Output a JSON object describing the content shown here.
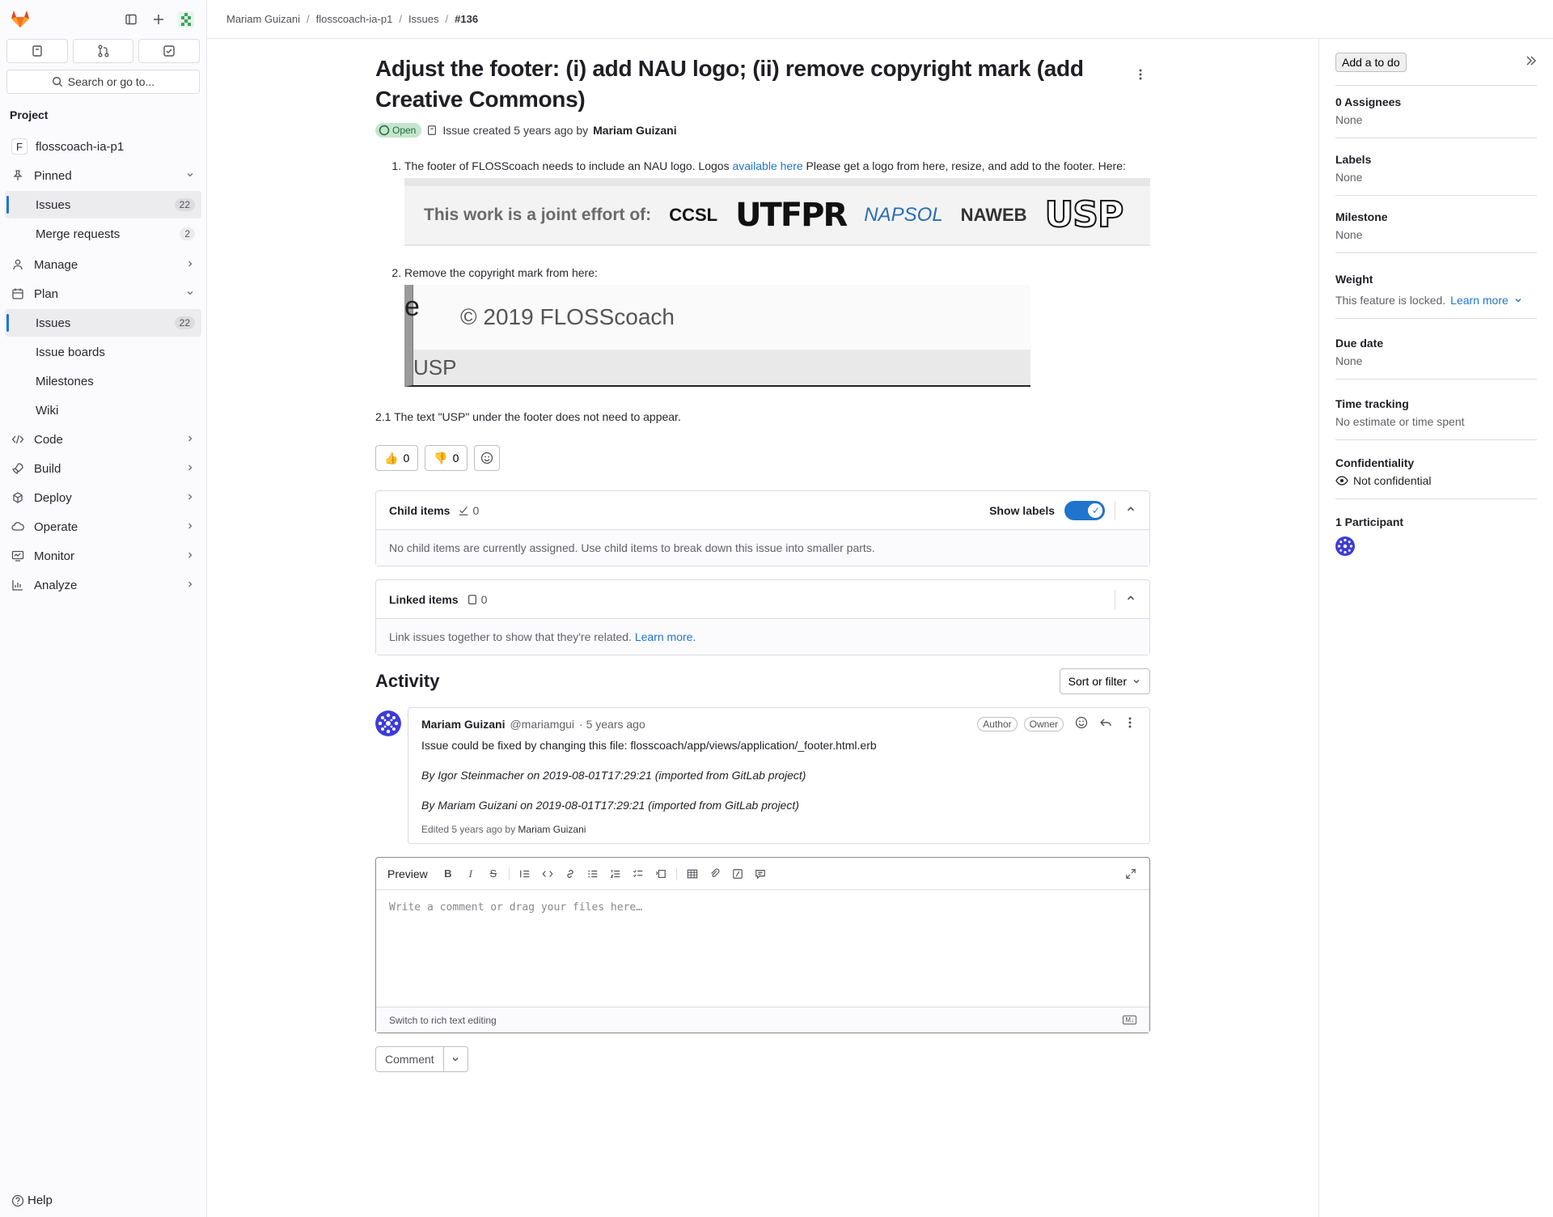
{
  "breadcrumb": [
    "Mariam Guizani",
    "flosscoach-ia-p1",
    "Issues",
    "#136"
  ],
  "sidebar": {
    "search_label": "Search or go to...",
    "section_title": "Project",
    "project_initial": "F",
    "project_name": "flosscoach-ia-p1",
    "pinned_label": "Pinned",
    "pinned_items": [
      {
        "label": "Issues",
        "count": "22"
      },
      {
        "label": "Merge requests",
        "count": "2"
      }
    ],
    "manage_label": "Manage",
    "plan_label": "Plan",
    "plan_items": [
      {
        "label": "Issues",
        "count": "22"
      },
      {
        "label": "Issue boards"
      },
      {
        "label": "Milestones"
      },
      {
        "label": "Wiki"
      }
    ],
    "groups": [
      "Code",
      "Build",
      "Deploy",
      "Operate",
      "Monitor",
      "Analyze"
    ],
    "help_label": "Help"
  },
  "issue": {
    "title": "Adjust the footer: (i) add NAU logo; (ii) remove copyright mark (add Creative Commons)",
    "status": "Open",
    "created_text": "Issue created 5 years ago by",
    "author": "Mariam Guizani",
    "desc_item1_pre": "The footer of FLOSScoach needs to include an NAU logo. Logos",
    "desc_item1_link": "available here",
    "desc_item1_post": "Please get a logo from here, resize, and add to the footer. Here:",
    "desc_item2": "Remove the copyright mark from here:",
    "desc_note": "2.1 The text \"USP\" under the footer does not need to appear.",
    "logos_image": {
      "joint_text": "This work is a joint effort of:",
      "logos": [
        "CCSL",
        "UTFPR",
        "NAPSOL",
        "NAWEB",
        "USP"
      ]
    },
    "copyright_image": {
      "text": "© 2019 FLOSScoach",
      "footer_text": "USP",
      "edge_glyph": "e"
    }
  },
  "reactions": {
    "thumbs_up": "0",
    "thumbs_down": "0"
  },
  "child_items": {
    "title": "Child items",
    "count": "0",
    "show_labels": "Show labels",
    "empty_text": "No child items are currently assigned. Use child items to break down this issue into smaller parts."
  },
  "linked_items": {
    "title": "Linked items",
    "count": "0",
    "text": "Link issues together to show that they're related.",
    "link": "Learn more."
  },
  "activity": {
    "title": "Activity",
    "sort_label": "Sort or filter",
    "note": {
      "author": "Mariam Guizani",
      "handle": "@mariamgui",
      "time": "· 5 years ago",
      "badges": [
        "Author",
        "Owner"
      ],
      "body": "Issue could be fixed by changing this file: flosscoach/app/views/application/_footer.html.erb",
      "line2": "By Igor Steinmacher on 2019-08-01T17:29:21 (imported from GitLab project)",
      "line3": "By Mariam Guizani on 2019-08-01T17:29:21 (imported from GitLab project)",
      "edited_prefix": "Edited 5 years ago by",
      "edited_by": "Mariam Guizani"
    }
  },
  "editor": {
    "preview_label": "Preview",
    "placeholder": "Write a comment or drag your files here…",
    "switch_label": "Switch to rich text editing",
    "md_badge": "M↓",
    "comment_label": "Comment"
  },
  "right_sidebar": {
    "todo_label": "Add a to do",
    "assignees_title": "0 Assignees",
    "assignees_value": "None",
    "labels_title": "Labels",
    "labels_value": "None",
    "milestone_title": "Milestone",
    "milestone_value": "None",
    "weight_title": "Weight",
    "weight_value": "This feature is locked.",
    "weight_link": "Learn more",
    "due_title": "Due date",
    "due_value": "None",
    "time_title": "Time tracking",
    "time_value": "No estimate or time spent",
    "conf_title": "Confidentiality",
    "conf_value": "Not confidential",
    "participants_title": "1 Participant"
  },
  "colors": {
    "accent": "#1f75cb",
    "open_badge_bg": "#c3e6cd",
    "open_badge_fg": "#24663b",
    "avatar": "#3d3bd8"
  }
}
